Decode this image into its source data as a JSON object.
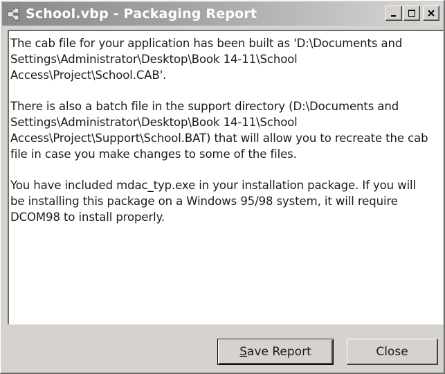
{
  "window": {
    "title": "School.vbp - Packaging Report",
    "controls": {
      "minimize": "_",
      "maximize": "□",
      "close": "×"
    }
  },
  "report": {
    "paragraphs": [
      "The cab file for your application has been built as 'D:\\Documents and Settings\\Administrator\\Desktop\\Book 14-11\\School Access\\Project\\School.CAB'.",
      "There is also a batch file in the support directory (D:\\Documents and Settings\\Administrator\\Desktop\\Book 14-11\\School Access\\Project\\Support\\School.BAT) that will allow you to recreate the cab file in case you make changes to some of the files.",
      "You have included mdac_typ.exe in your installation package.  If you will be installing this package on a Windows 95/98 system, it will require DCOM98 to install properly."
    ]
  },
  "buttons": {
    "save_label": "Save Report",
    "close_label": "Close"
  }
}
